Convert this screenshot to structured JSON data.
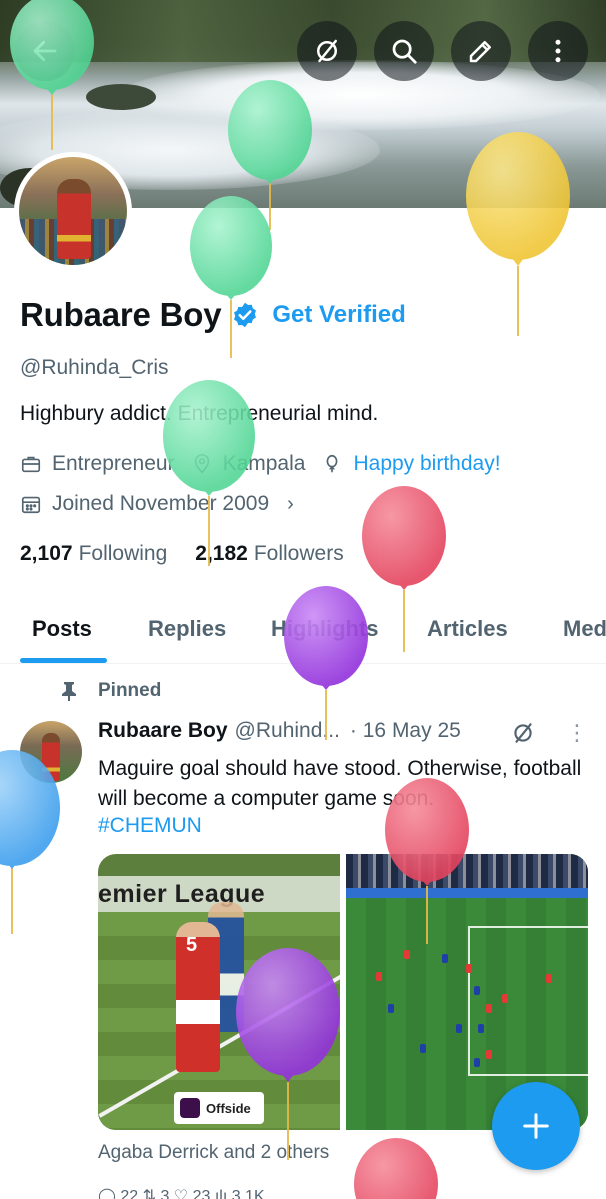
{
  "header": {
    "back_icon": "arrow-left-icon",
    "grok_icon": "grok-icon",
    "search_icon": "search-icon",
    "compose_icon": "pencil-icon",
    "more_icon": "more-vertical-icon"
  },
  "profile": {
    "name": "Rubaare Boy",
    "verified_icon": "verified-badge-icon",
    "get_verified_label": "Get Verified",
    "handle": "@Ruhinda_Cris",
    "bio": "Highbury addict. Entrepreneurial mind.",
    "profession": "Entrepreneur",
    "location": "Kampala",
    "birthday": "Happy birthday!",
    "joined": "Joined November 2009",
    "following_count": "2,107",
    "following_label": "Following",
    "followers_count": "2,182",
    "followers_label": "Followers",
    "accent_color": "#1d9bf0"
  },
  "tabs": [
    {
      "label": "Posts",
      "active": true
    },
    {
      "label": "Replies",
      "active": false
    },
    {
      "label": "Highlights",
      "active": false
    },
    {
      "label": "Articles",
      "active": false
    },
    {
      "label": "Media",
      "active": false
    }
  ],
  "pinned_post": {
    "pinned_label": "Pinned",
    "author_name": "Rubaare Boy",
    "author_handle": "@Ruhind...",
    "date": "· 16 May 25",
    "text": "Maguire goal should have stood. Otherwise, football will become a computer game soon.",
    "hashtag": "#CHEMUN",
    "media_left_text": "emier League",
    "media_left_badge": "5",
    "media_left_tag": "Offside",
    "liked_by": "Agaba Derrick and 2 others",
    "action_counts_partial": "◯ 22       ⇅ 3         ♡ 23          ılı 3.1K"
  },
  "fab": {
    "icon": "plus-icon"
  },
  "balloon_colors": {
    "green": "#5fdc9c",
    "yellow": "#f1cd45",
    "red": "#e8536a",
    "purple": "#9b3fe0",
    "blue": "#4aa8f0"
  }
}
